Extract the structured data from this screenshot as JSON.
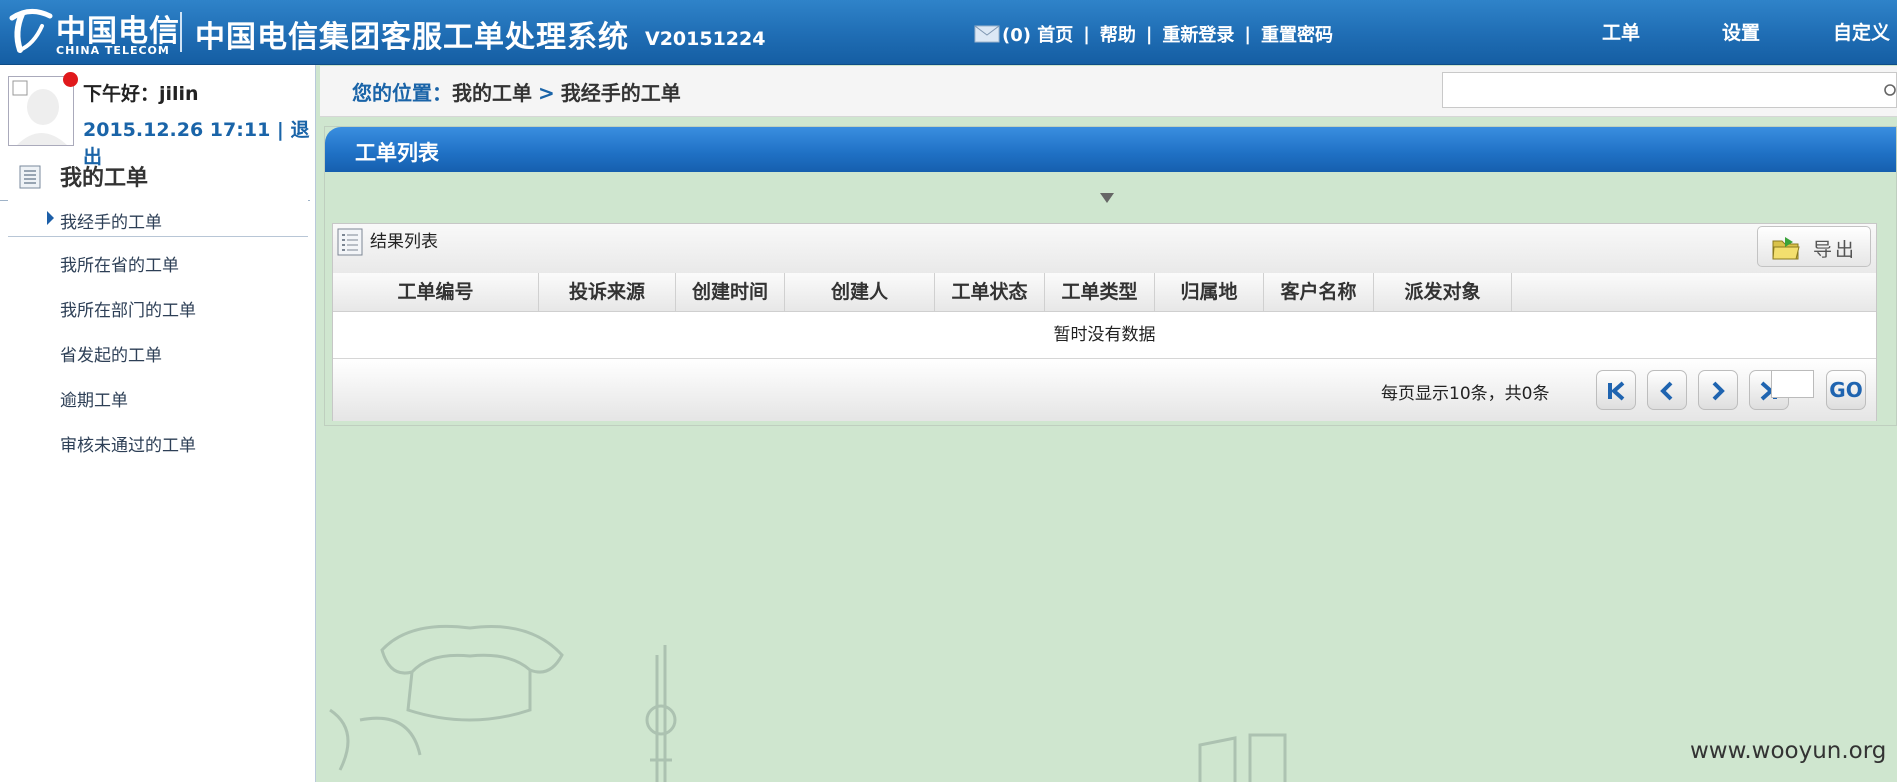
{
  "header": {
    "logo_cn": "中国电信",
    "logo_en": "CHINA TELECOM",
    "title": "中国电信集团客服工单处理系统",
    "version": "V20151224",
    "links": {
      "messages": "(0) 首页",
      "help": "帮助",
      "relogin": "重新登录",
      "reset_password": "重置密码",
      "sep": "|"
    },
    "nav": [
      "工单",
      "设置",
      "自定义"
    ]
  },
  "user": {
    "greeting": "下午好：jilin",
    "datetime": "2015.12.26 17:11",
    "sep": "|",
    "logout": "退出"
  },
  "sidebar": {
    "section_title": "我的工单",
    "items": [
      {
        "label": "我经手的工单"
      },
      {
        "label": "我所在省的工单"
      },
      {
        "label": "我所在部门的工单"
      },
      {
        "label": "省发起的工单"
      },
      {
        "label": "逾期工单"
      },
      {
        "label": "审核未通过的工单"
      }
    ]
  },
  "breadcrumb": {
    "prefix": "您的位置：",
    "level1": "我的工单",
    "arrow": ">",
    "level2": "我经手的工单"
  },
  "search": {
    "value": ""
  },
  "panel": {
    "title": "工单列表",
    "result_title": "结果列表",
    "export_label": "导出",
    "columns": [
      "工单编号",
      "投诉来源",
      "创建时间",
      "创建人",
      "工单状态",
      "工单类型",
      "归属地",
      "客户名称",
      "派发对象",
      ""
    ],
    "empty_text": "暂时没有数据",
    "pager_info": "每页显示10条，共0条",
    "go_label": "GO",
    "page_input": ""
  },
  "watermark": "www.wooyun.org",
  "colors": {
    "header_blue": "#1f6db4",
    "panel_blue": "#1f70c4",
    "page_bg": "#cfe6cf",
    "accent_red": "#e0191c"
  }
}
